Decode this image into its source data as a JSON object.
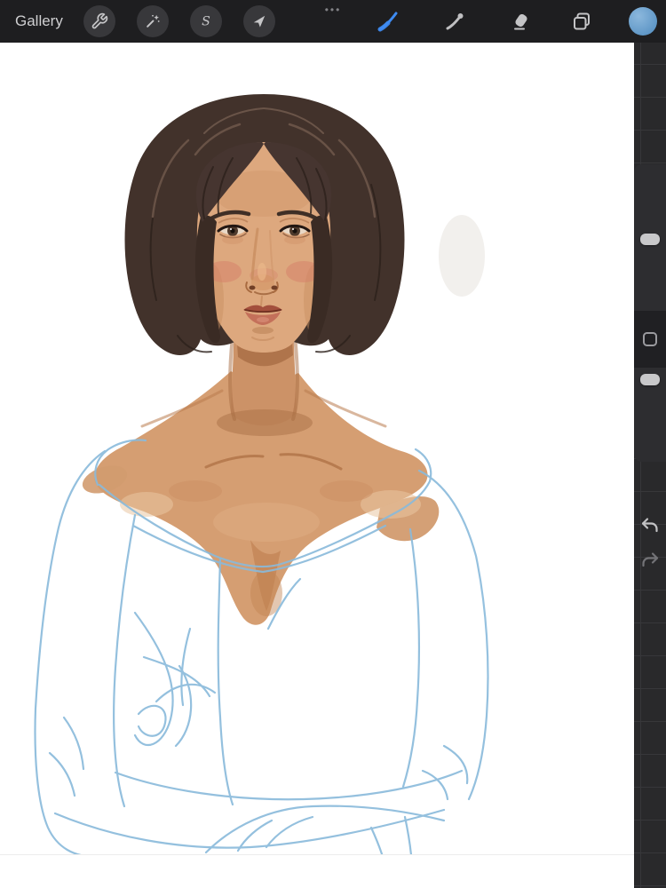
{
  "toolbar": {
    "gallery_label": "Gallery",
    "ellipsis_glyph": "•••",
    "left_tools": [
      {
        "id": "actions",
        "icon": "wrench-icon"
      },
      {
        "id": "adjustments",
        "icon": "magic-wand-icon"
      },
      {
        "id": "selection",
        "icon": "selection-s-icon",
        "glyph": "S"
      },
      {
        "id": "transform",
        "icon": "transform-arrow-icon"
      }
    ],
    "right_tools": [
      {
        "id": "paint",
        "icon": "paintbrush-icon",
        "active": true
      },
      {
        "id": "smudge",
        "icon": "smudge-brush-icon",
        "active": false
      },
      {
        "id": "erase",
        "icon": "eraser-icon",
        "active": false
      },
      {
        "id": "layers",
        "icon": "layers-icon",
        "active": false
      },
      {
        "id": "color",
        "icon": "color-swatch-icon",
        "swatch_color": "#6FA6D6",
        "active": false
      }
    ],
    "colors": {
      "background": "#1E1E20",
      "button_circle": "#38383B",
      "icon": "#C6C6C8",
      "active_accent": "#3E8BF2"
    }
  },
  "sidebar": {
    "brush_size_slider": {
      "label": "brush-size",
      "value_pct": 48
    },
    "modify_button": {
      "icon": "square-outline-icon"
    },
    "opacity_slider": {
      "label": "brush-opacity",
      "value_pct": 89
    },
    "undo_icon": "undo-arrow-icon",
    "redo_icon": "redo-arrow-icon",
    "colors": {
      "strip": "#2D2D30",
      "strip_dark": "#202023",
      "handle": "#C8C8CA"
    }
  },
  "workspace": {
    "background": "#29292B",
    "grid_line": "#37373A"
  },
  "canvas": {
    "background": "#FFFFFF",
    "artwork_description": "Work-in-progress digital portrait: woman with chin-length dark brown bob and curtain bangs, brown eyes, warm painted skin on face, neck and upper chest; white off-the-shoulder top and crossed arms indicated with loose light-blue sketch lines on a white canvas",
    "palette": {
      "hair": "#42322B",
      "skin": "#DDA87E",
      "skin_shadow": "#C28455",
      "blush": "#D5826A",
      "lips": "#B05B49",
      "sketch_blue": "#89BADB"
    }
  }
}
